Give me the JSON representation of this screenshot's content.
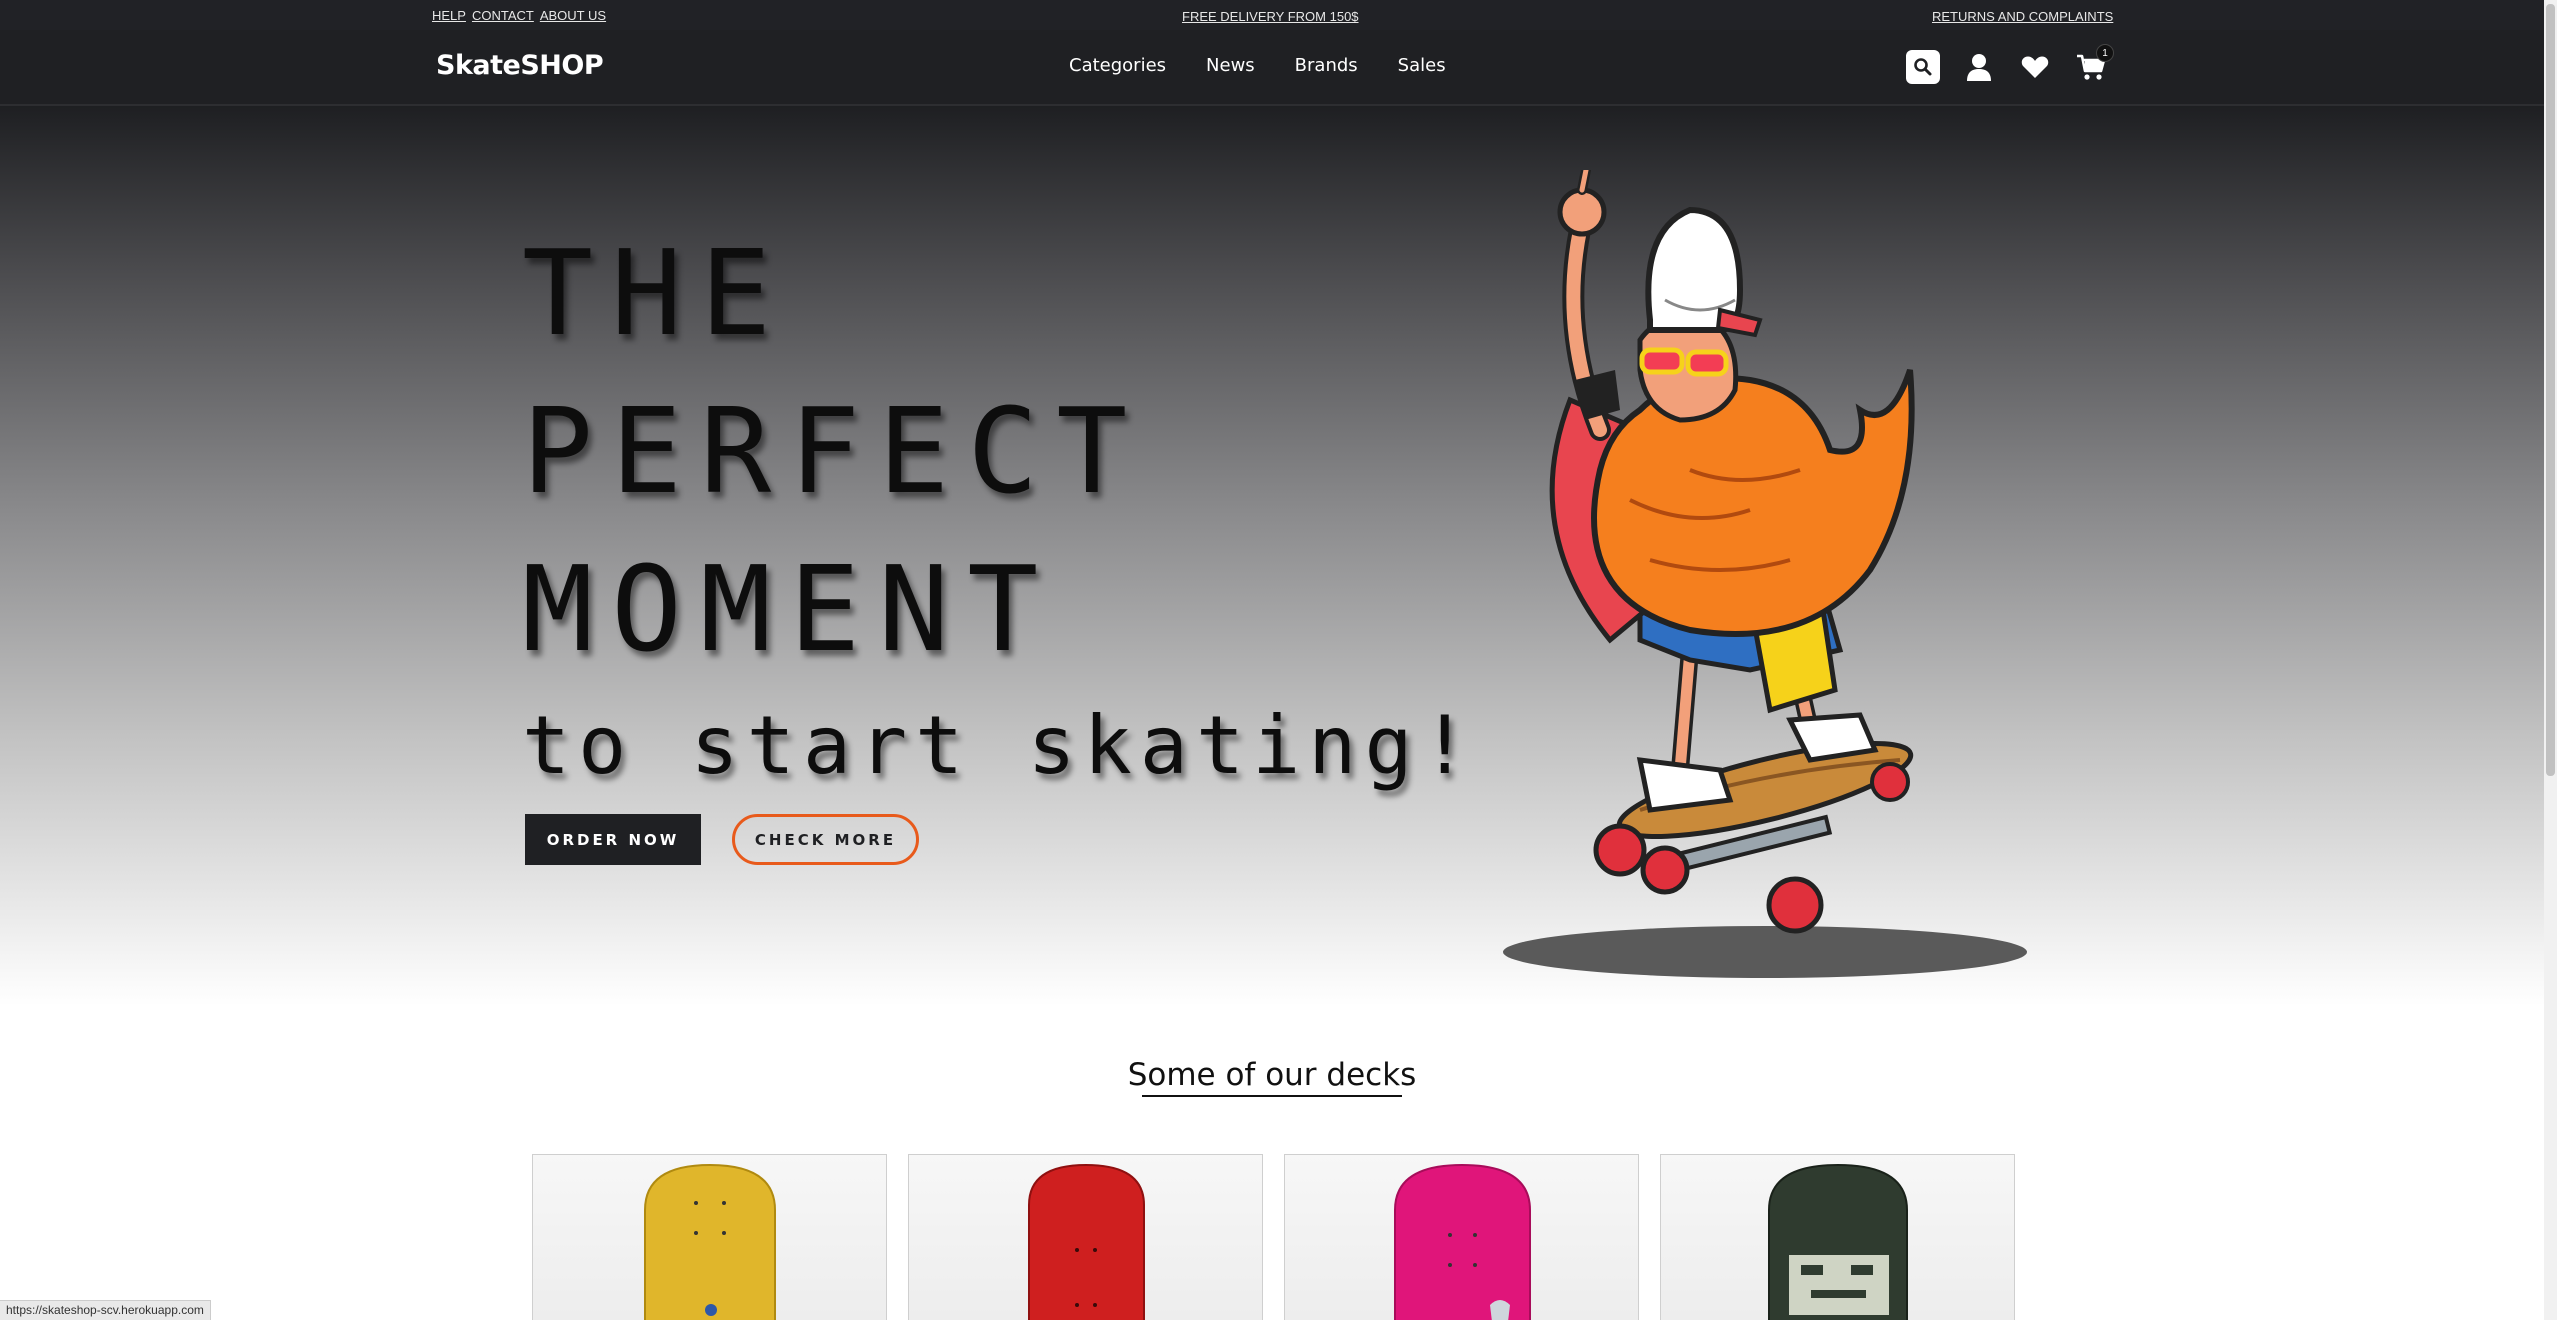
{
  "topbar": {
    "help": "HELP",
    "contact": "CONTACT",
    "about": "ABOUT US",
    "delivery": "FREE DELIVERY FROM 150$",
    "returns": "RETURNS AND COMPLAINTS"
  },
  "navbar": {
    "brand": "SkateSHOP",
    "links": [
      "Categories",
      "News",
      "Brands",
      "Sales"
    ],
    "icons": [
      "search-icon",
      "user-icon",
      "heart-icon",
      "cart-icon"
    ],
    "cart_count": "1"
  },
  "hero": {
    "line1": "THE",
    "line2": "PERFECT",
    "line3": "MOMENT",
    "line4": "to start skating!",
    "order_button": "ORDER NOW",
    "check_button": "CHECK MORE"
  },
  "decks_section": {
    "title": "Some of our decks",
    "cards": [
      {
        "color": "#e0b62b"
      },
      {
        "color": "#cf1f1f"
      },
      {
        "color": "#e0157a"
      },
      {
        "color": "#2f3b2f"
      }
    ]
  },
  "status_url": "https://skateshop-scv.herokuapp.com",
  "colors": {
    "accent": "#e85a1b",
    "dark": "#1f2023"
  }
}
